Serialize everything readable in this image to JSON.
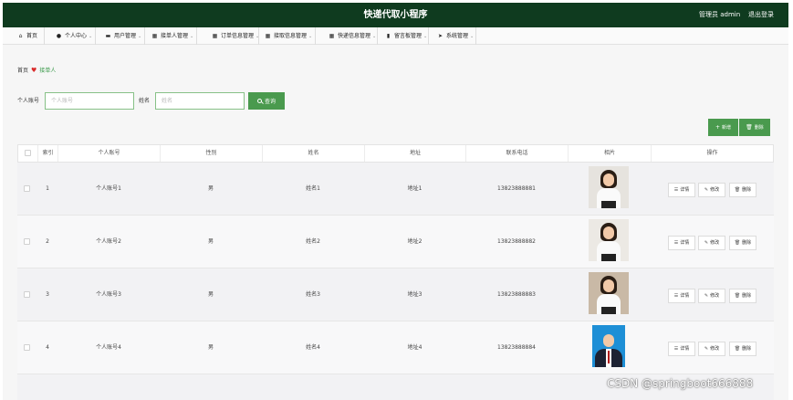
{
  "header": {
    "title": "快递代取小程序",
    "user_label": "管理员 admin",
    "logout_label": "退出登录"
  },
  "nav": [
    {
      "label": "首页",
      "icon": "home-icon",
      "has_dropdown": false
    },
    {
      "label": "个人中心",
      "icon": "user-icon",
      "has_dropdown": true
    },
    {
      "label": "用户管理",
      "icon": "chat-icon",
      "has_dropdown": true
    },
    {
      "label": "接单人管理",
      "icon": "grid-icon",
      "has_dropdown": true
    },
    {
      "label": "订单信息管理",
      "icon": "grid-icon",
      "has_dropdown": true
    },
    {
      "label": "接取信息管理",
      "icon": "grid-icon",
      "has_dropdown": true
    },
    {
      "label": "快递信息管理",
      "icon": "grid-icon",
      "has_dropdown": true
    },
    {
      "label": "留言板管理",
      "icon": "book-icon",
      "has_dropdown": true
    },
    {
      "label": "系统管理",
      "icon": "send-icon",
      "has_dropdown": true
    }
  ],
  "breadcrumb": {
    "home": "首页",
    "current": "接单人"
  },
  "search": {
    "account_label": "个人账号",
    "account_placeholder": "个人账号",
    "account_value": "",
    "name_label": "姓名",
    "name_placeholder": "姓名",
    "name_value": "",
    "button_label": "查询"
  },
  "toolbar": {
    "add_label": "新增",
    "delete_label": "删除"
  },
  "table": {
    "columns": [
      "索引",
      "个人账号",
      "性别",
      "姓名",
      "地址",
      "联系电话",
      "相片",
      "操作"
    ],
    "rows": [
      {
        "index": "1",
        "account": "个人账号1",
        "gender": "男",
        "name": "姓名1",
        "address": "地址1",
        "phone": "13823888881",
        "photo": "woman-portrait"
      },
      {
        "index": "2",
        "account": "个人账号2",
        "gender": "男",
        "name": "姓名2",
        "address": "地址2",
        "phone": "13823888882",
        "photo": "woman-portrait"
      },
      {
        "index": "3",
        "account": "个人账号3",
        "gender": "男",
        "name": "姓名3",
        "address": "地址3",
        "phone": "13823888883",
        "photo": "woman-portrait"
      },
      {
        "index": "4",
        "account": "个人账号4",
        "gender": "男",
        "name": "姓名4",
        "address": "地址4",
        "phone": "13823888884",
        "photo": "man-portrait-blue-bg"
      }
    ],
    "actions": {
      "detail": "详情",
      "edit": "修改",
      "delete": "删除"
    }
  },
  "watermark": "CSDN @springboot666888",
  "colors": {
    "header_bg": "#0f3b1f",
    "primary_green": "#4a9a4e",
    "input_border": "#87c187",
    "heart": "#d92b2b"
  }
}
